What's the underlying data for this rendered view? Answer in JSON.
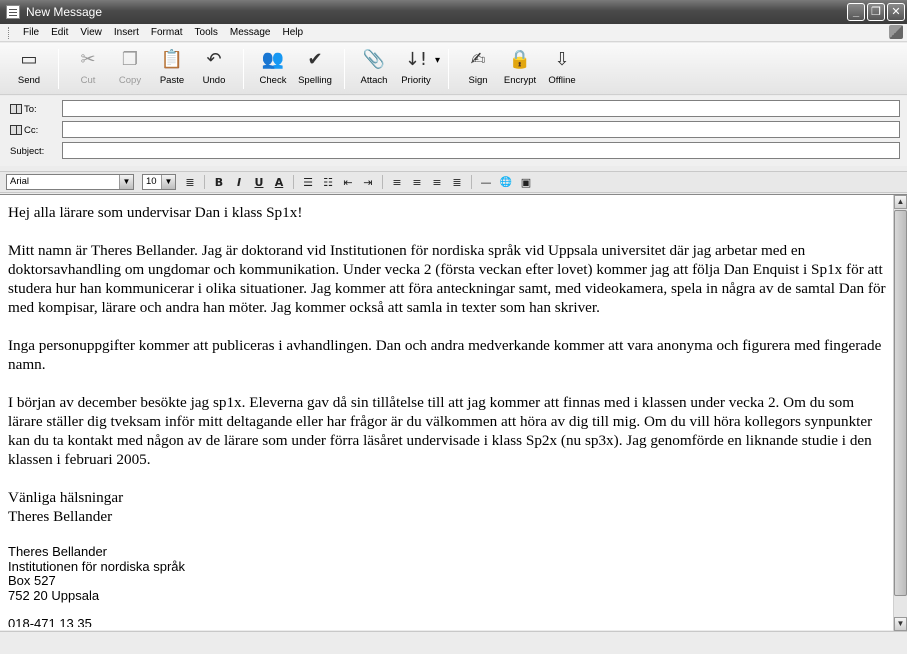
{
  "window": {
    "title": "New Message"
  },
  "menu": [
    "File",
    "Edit",
    "View",
    "Insert",
    "Format",
    "Tools",
    "Message",
    "Help"
  ],
  "toolbar": [
    {
      "label": "Send",
      "icon": "send-icon",
      "glyph": "▭",
      "enabled": true
    },
    {
      "label": "Cut",
      "icon": "scissors-icon",
      "glyph": "✂",
      "enabled": false
    },
    {
      "label": "Copy",
      "icon": "copy-icon",
      "glyph": "❐",
      "enabled": false
    },
    {
      "label": "Paste",
      "icon": "clipboard-icon",
      "glyph": "📋",
      "enabled": true
    },
    {
      "label": "Undo",
      "icon": "undo-icon",
      "glyph": "↶",
      "enabled": true
    },
    {
      "label": "Check",
      "icon": "check-names-icon",
      "glyph": "👥",
      "enabled": true
    },
    {
      "label": "Spelling",
      "icon": "spelling-check-icon",
      "glyph": "✔",
      "enabled": true
    },
    {
      "label": "Attach",
      "icon": "paperclip-icon",
      "glyph": "📎",
      "enabled": true
    },
    {
      "label": "Priority",
      "icon": "priority-icon",
      "glyph": "↓!",
      "enabled": true
    },
    {
      "label": "Sign",
      "icon": "sign-icon",
      "glyph": "✍",
      "enabled": true
    },
    {
      "label": "Encrypt",
      "icon": "encrypt-icon",
      "glyph": "🔒",
      "enabled": true
    },
    {
      "label": "Offline",
      "icon": "offline-icon",
      "glyph": "⇩",
      "enabled": true
    }
  ],
  "headers": {
    "to_label": "To:",
    "cc_label": "Cc:",
    "subject_label": "Subject:",
    "to_value": "",
    "cc_value": "",
    "subject_value": ""
  },
  "format": {
    "font": "Arial",
    "size": "10",
    "buttons": [
      {
        "name": "paragraph-style-icon",
        "glyph": "≣"
      },
      {
        "name": "bold-icon",
        "glyph": "B"
      },
      {
        "name": "italic-icon",
        "glyph": "I"
      },
      {
        "name": "underline-icon",
        "glyph": "U"
      },
      {
        "name": "font-color-icon",
        "glyph": "A"
      },
      {
        "name": "numbered-list-icon",
        "glyph": "☰"
      },
      {
        "name": "bullet-list-icon",
        "glyph": "☷"
      },
      {
        "name": "decrease-indent-icon",
        "glyph": "⇤"
      },
      {
        "name": "increase-indent-icon",
        "glyph": "⇥"
      },
      {
        "name": "align-left-icon",
        "glyph": "≡"
      },
      {
        "name": "align-center-icon",
        "glyph": "≡"
      },
      {
        "name": "align-right-icon",
        "glyph": "≡"
      },
      {
        "name": "justify-icon",
        "glyph": "≣"
      },
      {
        "name": "horizontal-line-icon",
        "glyph": "—"
      },
      {
        "name": "hyperlink-icon",
        "glyph": "🌐"
      },
      {
        "name": "insert-picture-icon",
        "glyph": "▣"
      }
    ]
  },
  "body": {
    "greeting": "Hej alla lärare som undervisar Dan i klass Sp1x!",
    "paragraphs": [
      "Mitt namn är Theres Bellander. Jag är doktorand vid Institutionen för nordiska språk vid Uppsala universitet där jag arbetar med en doktorsavhandling om ungdomar och kommunikation. Under vecka 2 (första veckan efter lovet) kommer jag att följa Dan Enquist i Sp1x för att studera hur han kommunicerar i olika situationer. Jag kommer att föra anteckningar samt, med videokamera, spela in några av de samtal Dan för med kompisar, lärare och andra han möter. Jag kommer också att samla in texter som han skriver.",
      "Inga personuppgifter kommer att publiceras i avhandlingen. Dan och andra medverkande kommer att vara anonyma och figurera med fingerade namn.",
      "I början av december besökte jag sp1x. Eleverna gav då sin tillåtelse till att jag kommer att finnas med i klassen under vecka 2. Om du som lärare ställer dig tveksam inför mitt deltagande eller har frågor är du välkommen att höra av dig till mig. Om du vill höra kollegors synpunkter kan du ta kontakt med någon av de lärare som under förra läsåret undervisade i klass Sp2x (nu sp3x). Jag genomförde en liknande studie i den klassen i februari 2005."
    ],
    "closing_1": "Vänliga hälsningar",
    "closing_2": "Theres Bellander",
    "signature": {
      "name": "Theres Bellander",
      "dept": "Institutionen för nordiska språk",
      "box": "Box 527",
      "city": "752 20 Uppsala",
      "phone": "018-471 13 35"
    }
  }
}
